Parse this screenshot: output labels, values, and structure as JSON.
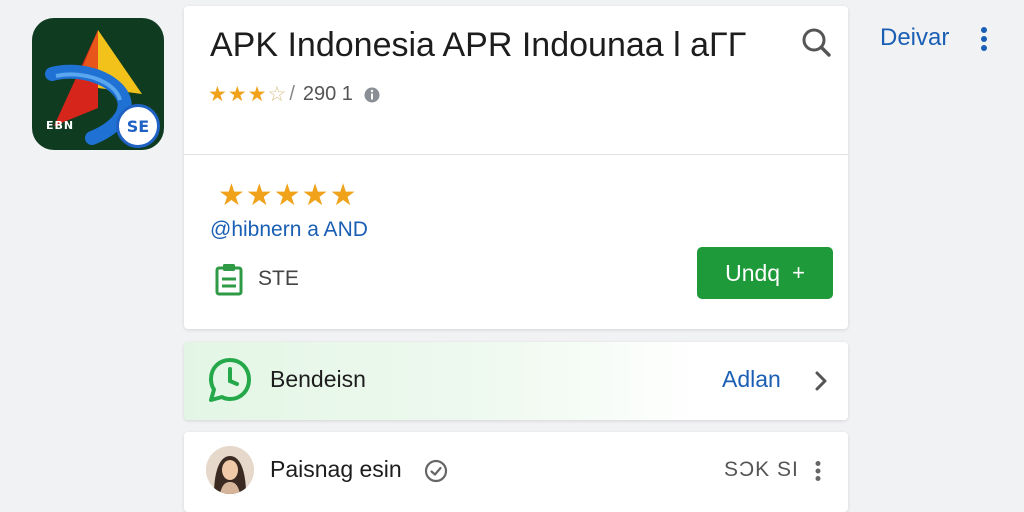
{
  "app": {
    "title": "APK Indonesia APR Indounaa l aΓΓ",
    "icon_mark": "EBN",
    "icon_badge": "SE",
    "rating_stars": "★★★",
    "rating_stars_partial": "☆",
    "rating_slash": "/",
    "rating_count": "290 1",
    "rating_stars_large": "★★★★★",
    "publisher": "@hibnern a AND",
    "meta_label": "STE",
    "install_label": "Undq",
    "install_symbol": "+"
  },
  "top": {
    "action_label": "Deivar"
  },
  "rows": [
    {
      "label": "Bendeisn",
      "action": "Adlan"
    },
    {
      "label": "Paisnag esin",
      "value": "SƆK SI"
    }
  ],
  "colors": {
    "accent_blue": "#1a5fb4",
    "install_green": "#1f9a3a",
    "star": "#f0a21a",
    "whatsapp_green": "#25a84a"
  },
  "icons": [
    "search-icon",
    "info-icon",
    "document-icon",
    "whatsapp-icon",
    "chevron-right-icon",
    "verified-icon",
    "more-vertical-icon"
  ]
}
